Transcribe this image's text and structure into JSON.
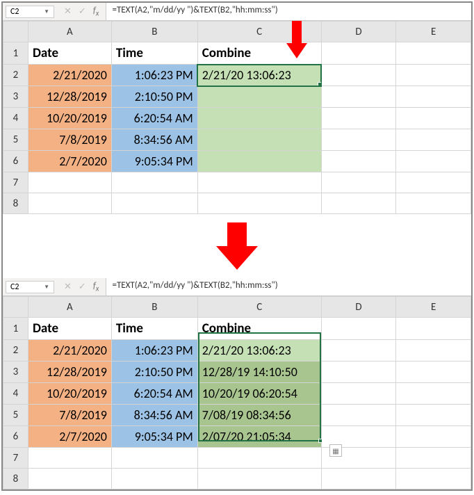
{
  "namebox": "C2",
  "formula": "=TEXT(A2,\"m/dd/yy \")&TEXT(B2,\"hh:mm:ss\")",
  "columns": [
    "A",
    "B",
    "C",
    "D",
    "E"
  ],
  "headers": {
    "A": "Date",
    "B": "Time",
    "C": "Combine"
  },
  "rows_top": [
    {
      "n": "2",
      "date": "2/21/2020",
      "time": "1:06:23 PM",
      "combine": "2/21/20 13:06:23"
    },
    {
      "n": "3",
      "date": "12/28/2019",
      "time": "2:10:50 PM",
      "combine": ""
    },
    {
      "n": "4",
      "date": "10/20/2019",
      "time": "6:20:54 AM",
      "combine": ""
    },
    {
      "n": "5",
      "date": "7/8/2019",
      "time": "8:34:56 AM",
      "combine": ""
    },
    {
      "n": "6",
      "date": "2/7/2020",
      "time": "9:05:34 PM",
      "combine": ""
    }
  ],
  "extra_rows_top": [
    "7",
    "8"
  ],
  "rows_bottom": [
    {
      "n": "2",
      "date": "2/21/2020",
      "time": "1:06:23 PM",
      "combine": "2/21/20 13:06:23"
    },
    {
      "n": "3",
      "date": "12/28/2019",
      "time": "2:10:50 PM",
      "combine": "12/28/19 14:10:50"
    },
    {
      "n": "4",
      "date": "10/20/2019",
      "time": "6:20:54 AM",
      "combine": "10/20/19 06:20:54"
    },
    {
      "n": "5",
      "date": "7/8/2019",
      "time": "8:34:56 AM",
      "combine": "7/08/19 08:34:56"
    },
    {
      "n": "6",
      "date": "2/7/2020",
      "time": "9:05:34 PM",
      "combine": "2/07/20 21:05:34"
    }
  ],
  "extra_rows_bottom": [
    "7",
    "8"
  ],
  "row1": "1"
}
